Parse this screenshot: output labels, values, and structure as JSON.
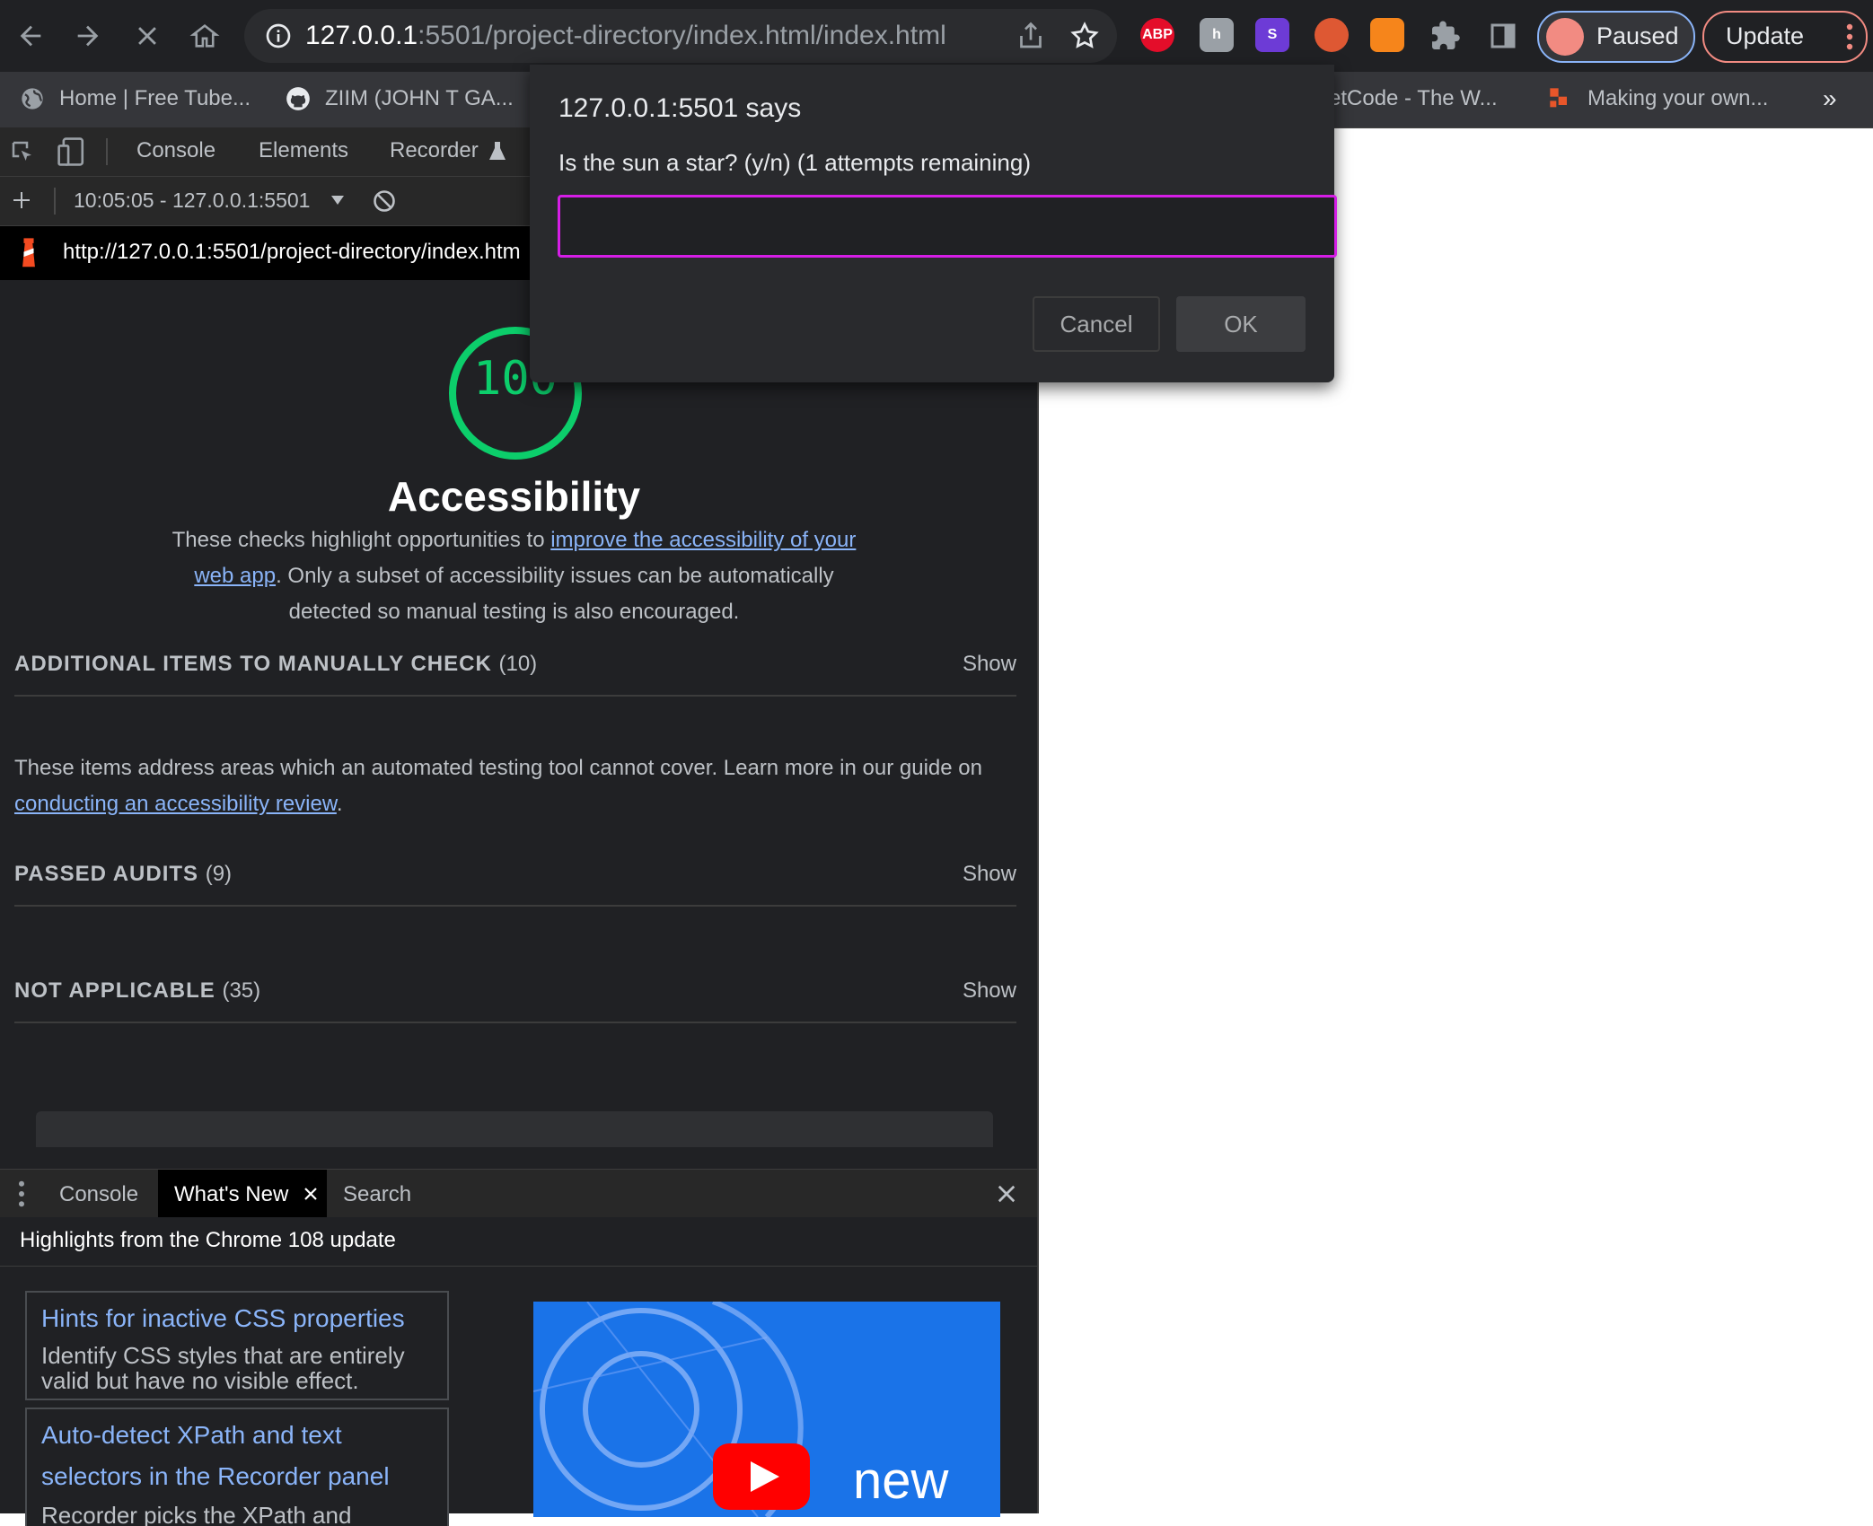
{
  "browser": {
    "url_host": "127.0.0.1",
    "url_rest": ":5501/project-directory/index.html/index.html",
    "extensions": [
      {
        "name": "adblock-plus-icon",
        "text": "ABP",
        "color": "#e40d2a"
      },
      {
        "name": "extension-h-icon",
        "text": "h",
        "color": "#9aa0a6"
      },
      {
        "name": "extension-s-icon",
        "text": "S",
        "color": "#6d3bd6"
      },
      {
        "name": "duckduckgo-icon",
        "text": "",
        "color": "#de5833"
      },
      {
        "name": "metamask-fox-icon",
        "text": "",
        "color": "#f6851b"
      }
    ],
    "profile_label": "Paused",
    "update_label": "Update"
  },
  "bookmarks": {
    "items": [
      "Home | Free Tube...",
      "ZIIM (JOHN T GA...",
      "etCode - The W...",
      "Making your own..."
    ],
    "overflow": "»"
  },
  "devtools": {
    "tabs": [
      "Console",
      "Elements",
      "Recorder"
    ],
    "session": "10:05:05 - 127.0.0.1:5501",
    "report_url": "http://127.0.0.1:5501/project-directory/index.htm",
    "score": "100",
    "category_title": "Accessibility",
    "desc_before": "These checks highlight opportunities to ",
    "desc_link": "improve the accessibility of your web app",
    "desc_after": ". Only a subset of accessibility issues can be automatically detected so manual testing is also encouraged.",
    "sections": [
      {
        "title": "ADDITIONAL ITEMS TO MANUALLY CHECK",
        "count": "(10)",
        "action": "Show"
      },
      {
        "title": "PASSED AUDITS",
        "count": "(9)",
        "action": "Show"
      },
      {
        "title": "NOT APPLICABLE",
        "count": "(35)",
        "action": "Show"
      }
    ],
    "manual_before": "These items address areas which an automated testing tool cannot cover. Learn more in our guide on ",
    "manual_link": "conducting an accessibility review",
    "manual_after": ".",
    "drawer_tabs": [
      "Console",
      "What's New",
      "Search"
    ],
    "drawer_heading": "Highlights from the Chrome 108 update",
    "cards": [
      {
        "title": "Hints for inactive CSS properties",
        "desc": "Identify CSS styles that are entirely valid but have no visible effect."
      },
      {
        "title": "Auto-detect XPath and text selectors in the Recorder panel",
        "desc": "Recorder picks the XPath and"
      }
    ],
    "video_text": "new"
  },
  "dialog": {
    "title": "127.0.0.1:5501 says",
    "message": "Is the sun a star? (y/n) (1 attempts remaining)",
    "input_value": "",
    "cancel_label": "Cancel",
    "ok_label": "OK",
    "focus_color": "#d51ee6"
  }
}
